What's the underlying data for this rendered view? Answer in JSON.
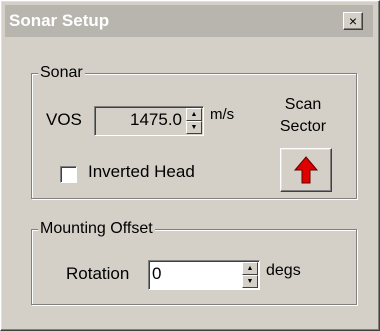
{
  "window": {
    "title": "Sonar Setup",
    "close_glyph": "×"
  },
  "sonar_group": {
    "legend": "Sonar",
    "vos_label": "VOS",
    "vos_value": "1475.0",
    "vos_unit": "m/s",
    "scan_sector_line1": "Scan",
    "scan_sector_line2": "Sector",
    "scan_sector_icon": "red-up-arrow-icon",
    "inverted_head_label": "Inverted Head",
    "inverted_head_checked": false
  },
  "mounting_group": {
    "legend": "Mounting Offset",
    "rotation_label": "Rotation",
    "rotation_value": "0",
    "rotation_unit": "degs"
  },
  "colors": {
    "face": "#d4d0c8",
    "arrow": "#e00000",
    "title_bar": "#b8b5ae"
  }
}
